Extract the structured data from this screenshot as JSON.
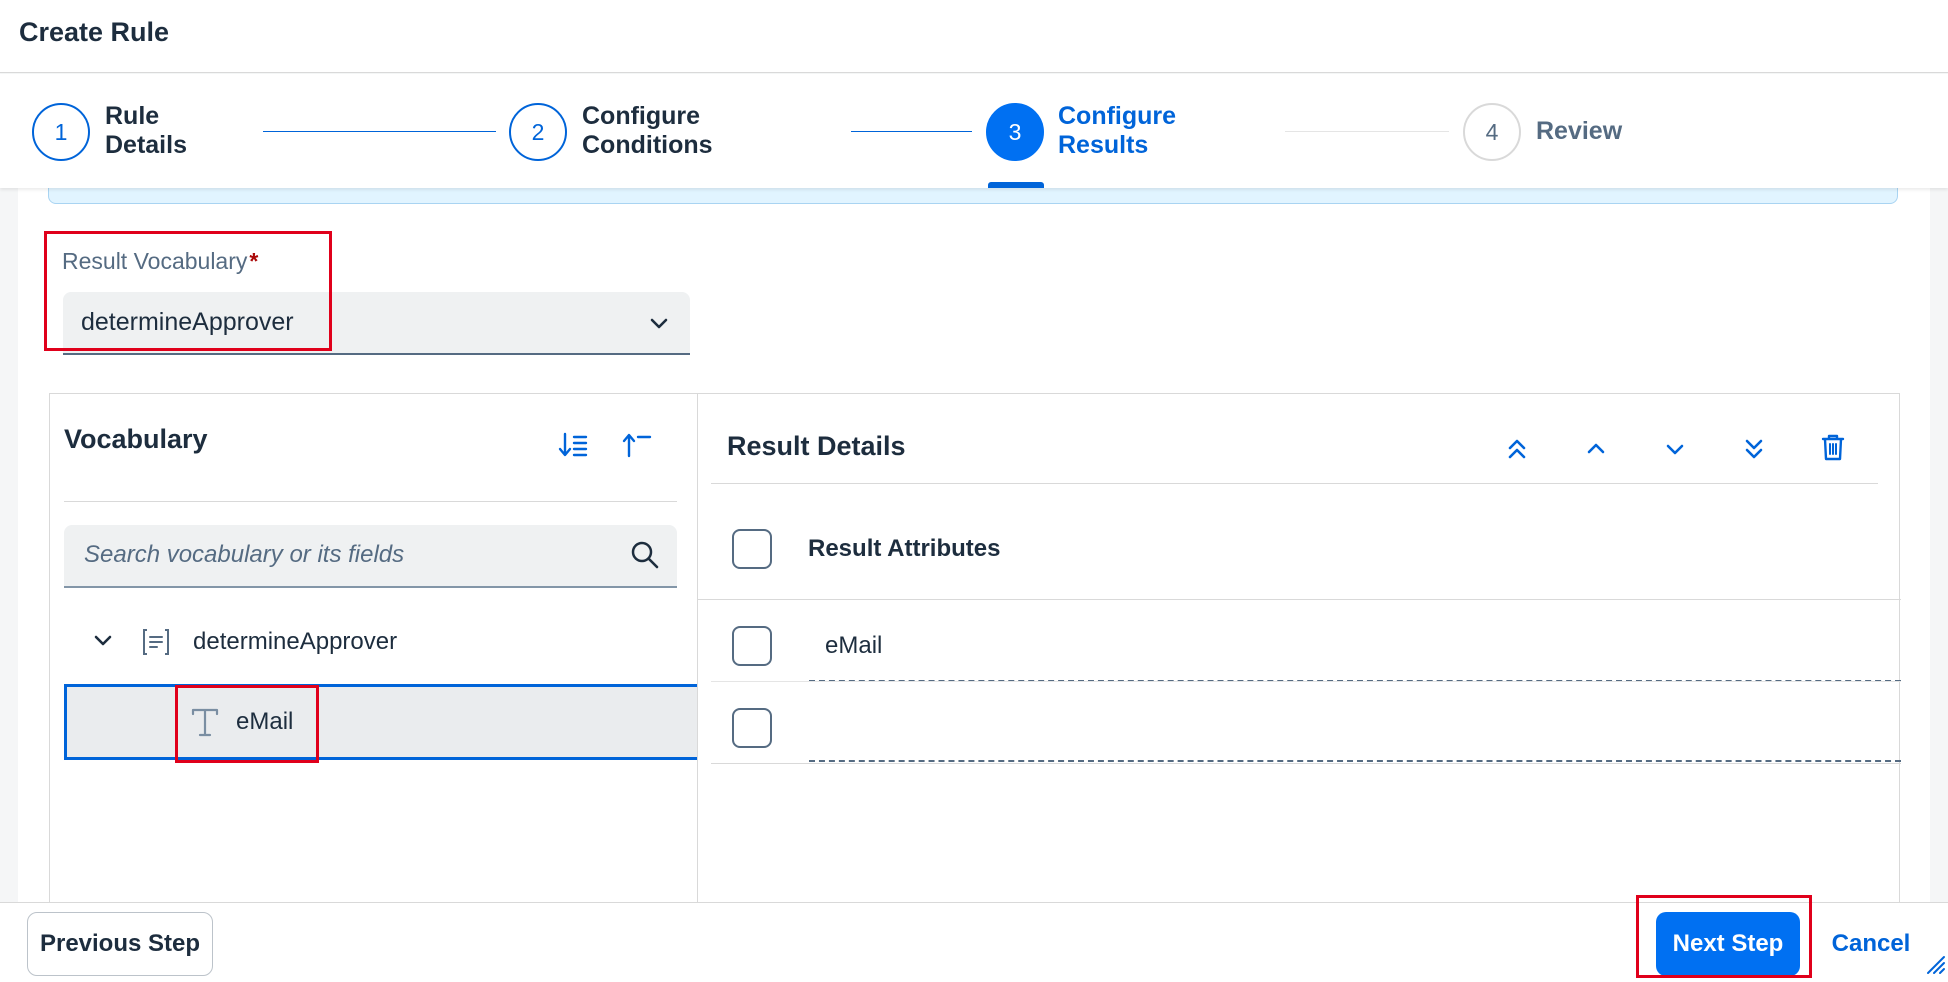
{
  "dialog": {
    "title": "Create Rule"
  },
  "wizard": {
    "steps": [
      {
        "number": "1",
        "line1": "Rule",
        "line2": "Details",
        "state": "completed"
      },
      {
        "number": "2",
        "line1": "Configure",
        "line2": "Conditions",
        "state": "completed"
      },
      {
        "number": "3",
        "line1": "Configure",
        "line2": "Results",
        "state": "active"
      },
      {
        "number": "4",
        "line1": "Review",
        "line2": "",
        "state": "future"
      }
    ]
  },
  "result_vocabulary": {
    "label": "Result Vocabulary",
    "required_marker": "*",
    "value": "determineApprover"
  },
  "vocabulary_panel": {
    "title": "Vocabulary",
    "search_placeholder": "Search vocabulary or its fields",
    "tree": {
      "parent": "determineApprover",
      "child": "eMail"
    }
  },
  "result_details": {
    "title": "Result Details",
    "column_header": "Result Attributes",
    "rows": [
      {
        "value": "eMail"
      },
      {
        "value": ""
      }
    ]
  },
  "footer": {
    "previous_label": "Previous Step",
    "next_label": "Next Step",
    "cancel_label": "Cancel"
  },
  "colors": {
    "accent": "#0070f2",
    "highlight": "#e0001b",
    "required": "#aa0808"
  }
}
